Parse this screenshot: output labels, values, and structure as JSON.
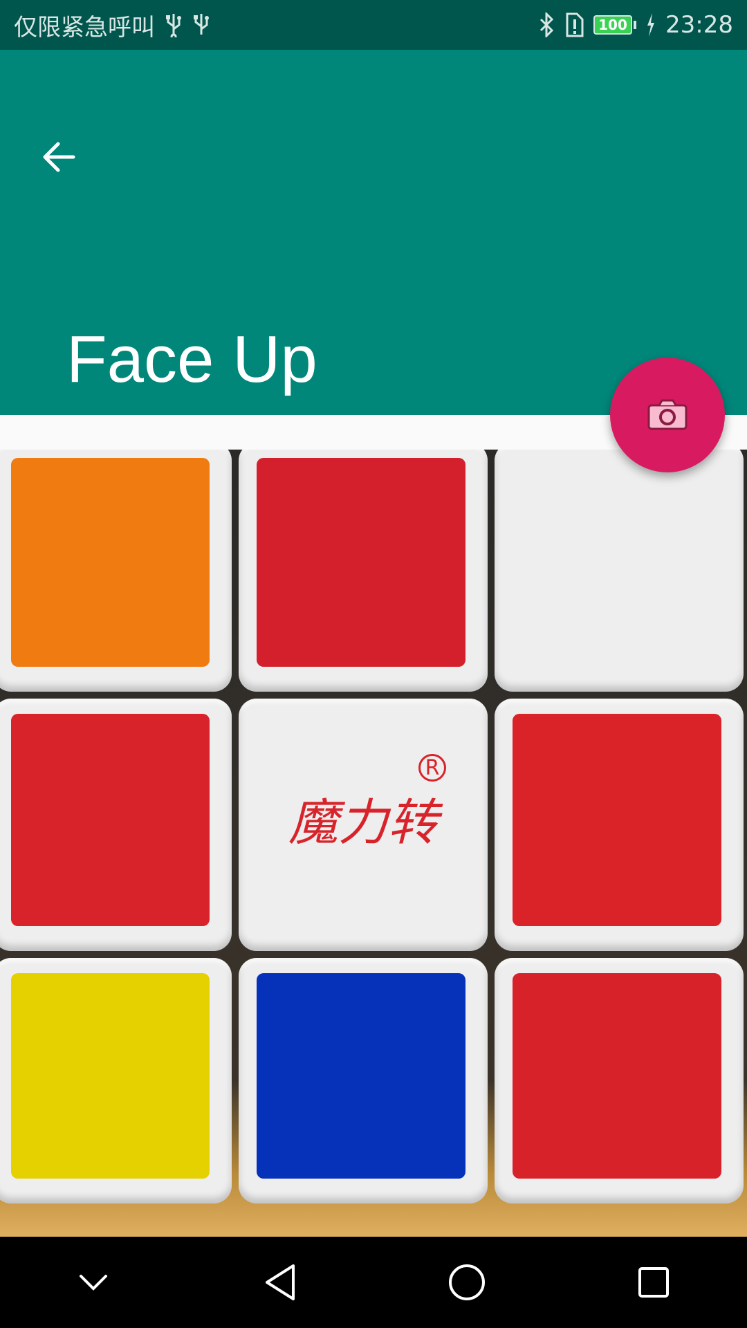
{
  "status_bar": {
    "carrier_text": "仅限紧急呼叫",
    "battery_level": "100",
    "time": "23:28",
    "icons": [
      "usb-icon",
      "usb-icon",
      "bluetooth-icon",
      "alert-icon",
      "battery-icon",
      "charging-icon"
    ]
  },
  "app_bar": {
    "title": "Face Up",
    "back_icon": "arrow-back-icon",
    "color": "#00877a"
  },
  "fab": {
    "icon": "camera-icon",
    "color": "#d81b60"
  },
  "cube_face": {
    "center_logo_text": "魔力转",
    "stickers": [
      [
        "#f07b10",
        "#d3202c",
        "#eeeeee"
      ],
      [
        "#d8232a",
        "#eeeeee",
        "#da2229"
      ],
      [
        "#e5d000",
        "#0532b8",
        "#d8222a"
      ]
    ]
  },
  "nav_bar": {
    "buttons": [
      "collapse-icon",
      "back-icon",
      "home-icon",
      "recents-icon"
    ]
  }
}
